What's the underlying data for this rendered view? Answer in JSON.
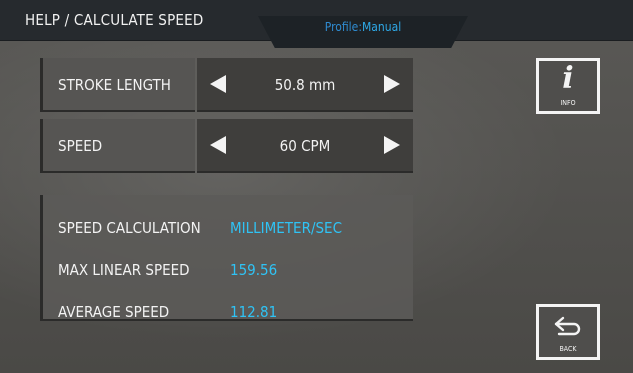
{
  "header": {
    "title": "HELP / CALCULATE SPEED",
    "profile_label": "Profile:",
    "profile_value": "Manual"
  },
  "rows": [
    {
      "label": "STROKE LENGTH",
      "value": "50.8 mm"
    },
    {
      "label": "SPEED",
      "value": "60 CPM"
    }
  ],
  "calculation": {
    "speed_calc_label": "SPEED CALCULATION",
    "speed_calc_value": "MILLIMETER/SEC",
    "max_label": "MAX LINEAR SPEED",
    "max_value": "159.56",
    "avg_label": "AVERAGE SPEED",
    "avg_value": "112.81"
  },
  "buttons": {
    "info_glyph": "i",
    "info_caption": "INFO",
    "back_caption": "BACK"
  },
  "icons": [
    "arrow-left-icon",
    "arrow-right-icon",
    "info-icon",
    "back-arrow-icon"
  ],
  "colors": {
    "accent_blue": "#2fc3f5",
    "header_bg": "#262a2e",
    "panel_bg": "#565553"
  }
}
